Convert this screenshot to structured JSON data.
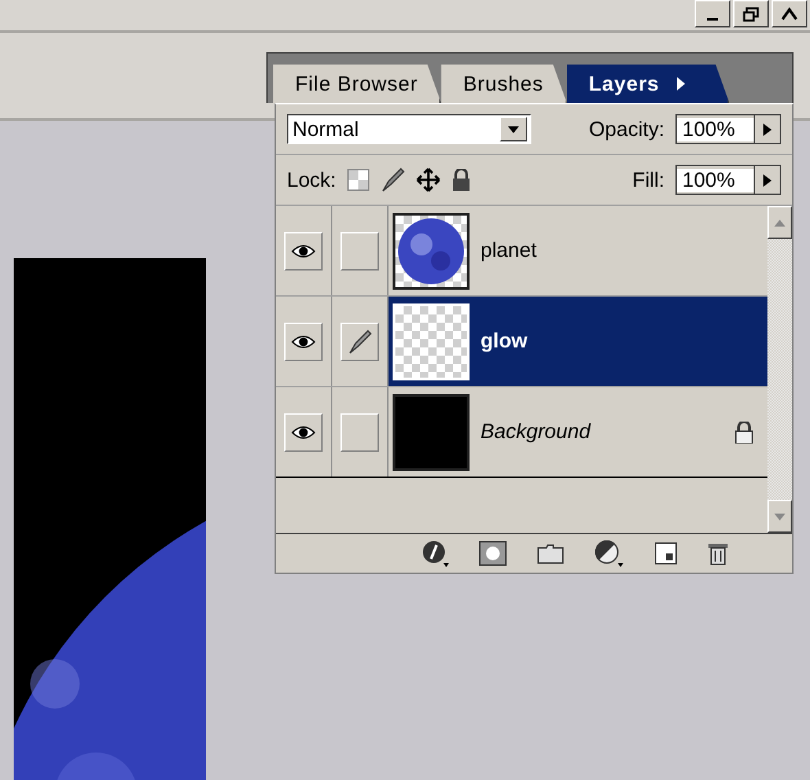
{
  "tabs": [
    {
      "label": "File Browser",
      "selected": false
    },
    {
      "label": "Brushes",
      "selected": false
    },
    {
      "label": "Layers",
      "selected": true
    }
  ],
  "blend_mode": {
    "value": "Normal"
  },
  "opacity": {
    "label": "Opacity:",
    "value": "100%"
  },
  "lock": {
    "label": "Lock:"
  },
  "fill": {
    "label": "Fill:",
    "value": "100%"
  },
  "layers": [
    {
      "name": "planet",
      "selected": false,
      "visible": true,
      "kind": "image",
      "locked": false
    },
    {
      "name": "glow",
      "selected": true,
      "visible": true,
      "kind": "empty",
      "locked": false
    },
    {
      "name": "Background",
      "selected": false,
      "visible": true,
      "kind": "background",
      "locked": true
    }
  ]
}
